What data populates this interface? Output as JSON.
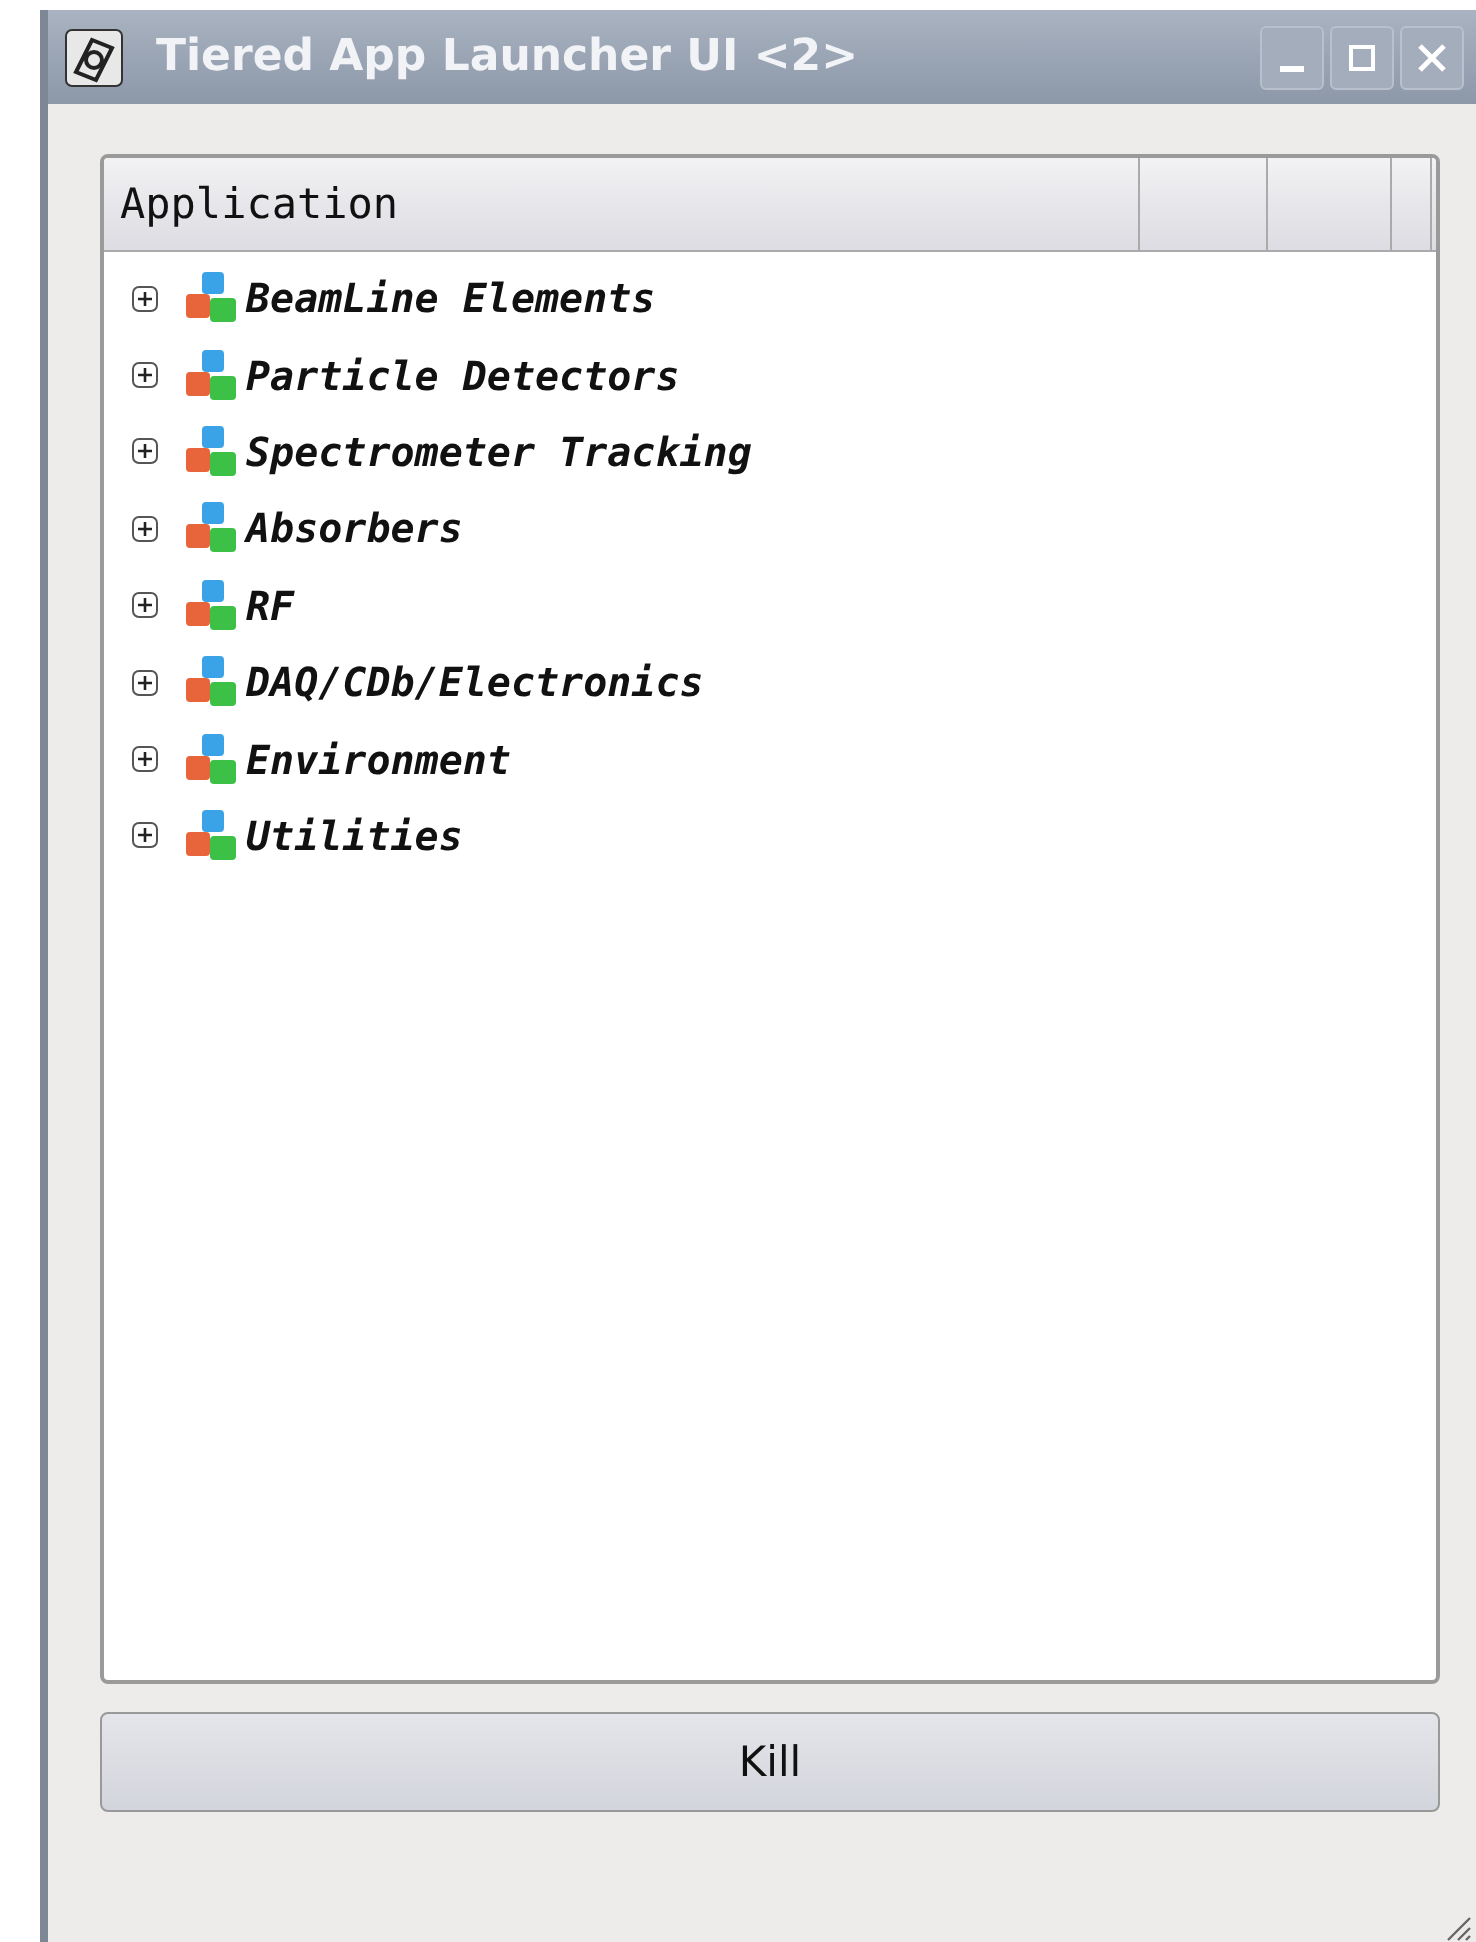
{
  "window": {
    "title": "Tiered App Launcher UI <2>"
  },
  "tree": {
    "columns": [
      "Application"
    ],
    "items": [
      {
        "label": "BeamLine Elements",
        "expanded": false
      },
      {
        "label": "Particle Detectors",
        "expanded": false
      },
      {
        "label": "Spectrometer Tracking",
        "expanded": false
      },
      {
        "label": "Absorbers",
        "expanded": false
      },
      {
        "label": "RF",
        "expanded": false
      },
      {
        "label": "DAQ/CDb/Electronics",
        "expanded": false
      },
      {
        "label": "Environment",
        "expanded": false
      },
      {
        "label": "Utilities",
        "expanded": false
      }
    ]
  },
  "buttons": [
    "Kill"
  ]
}
